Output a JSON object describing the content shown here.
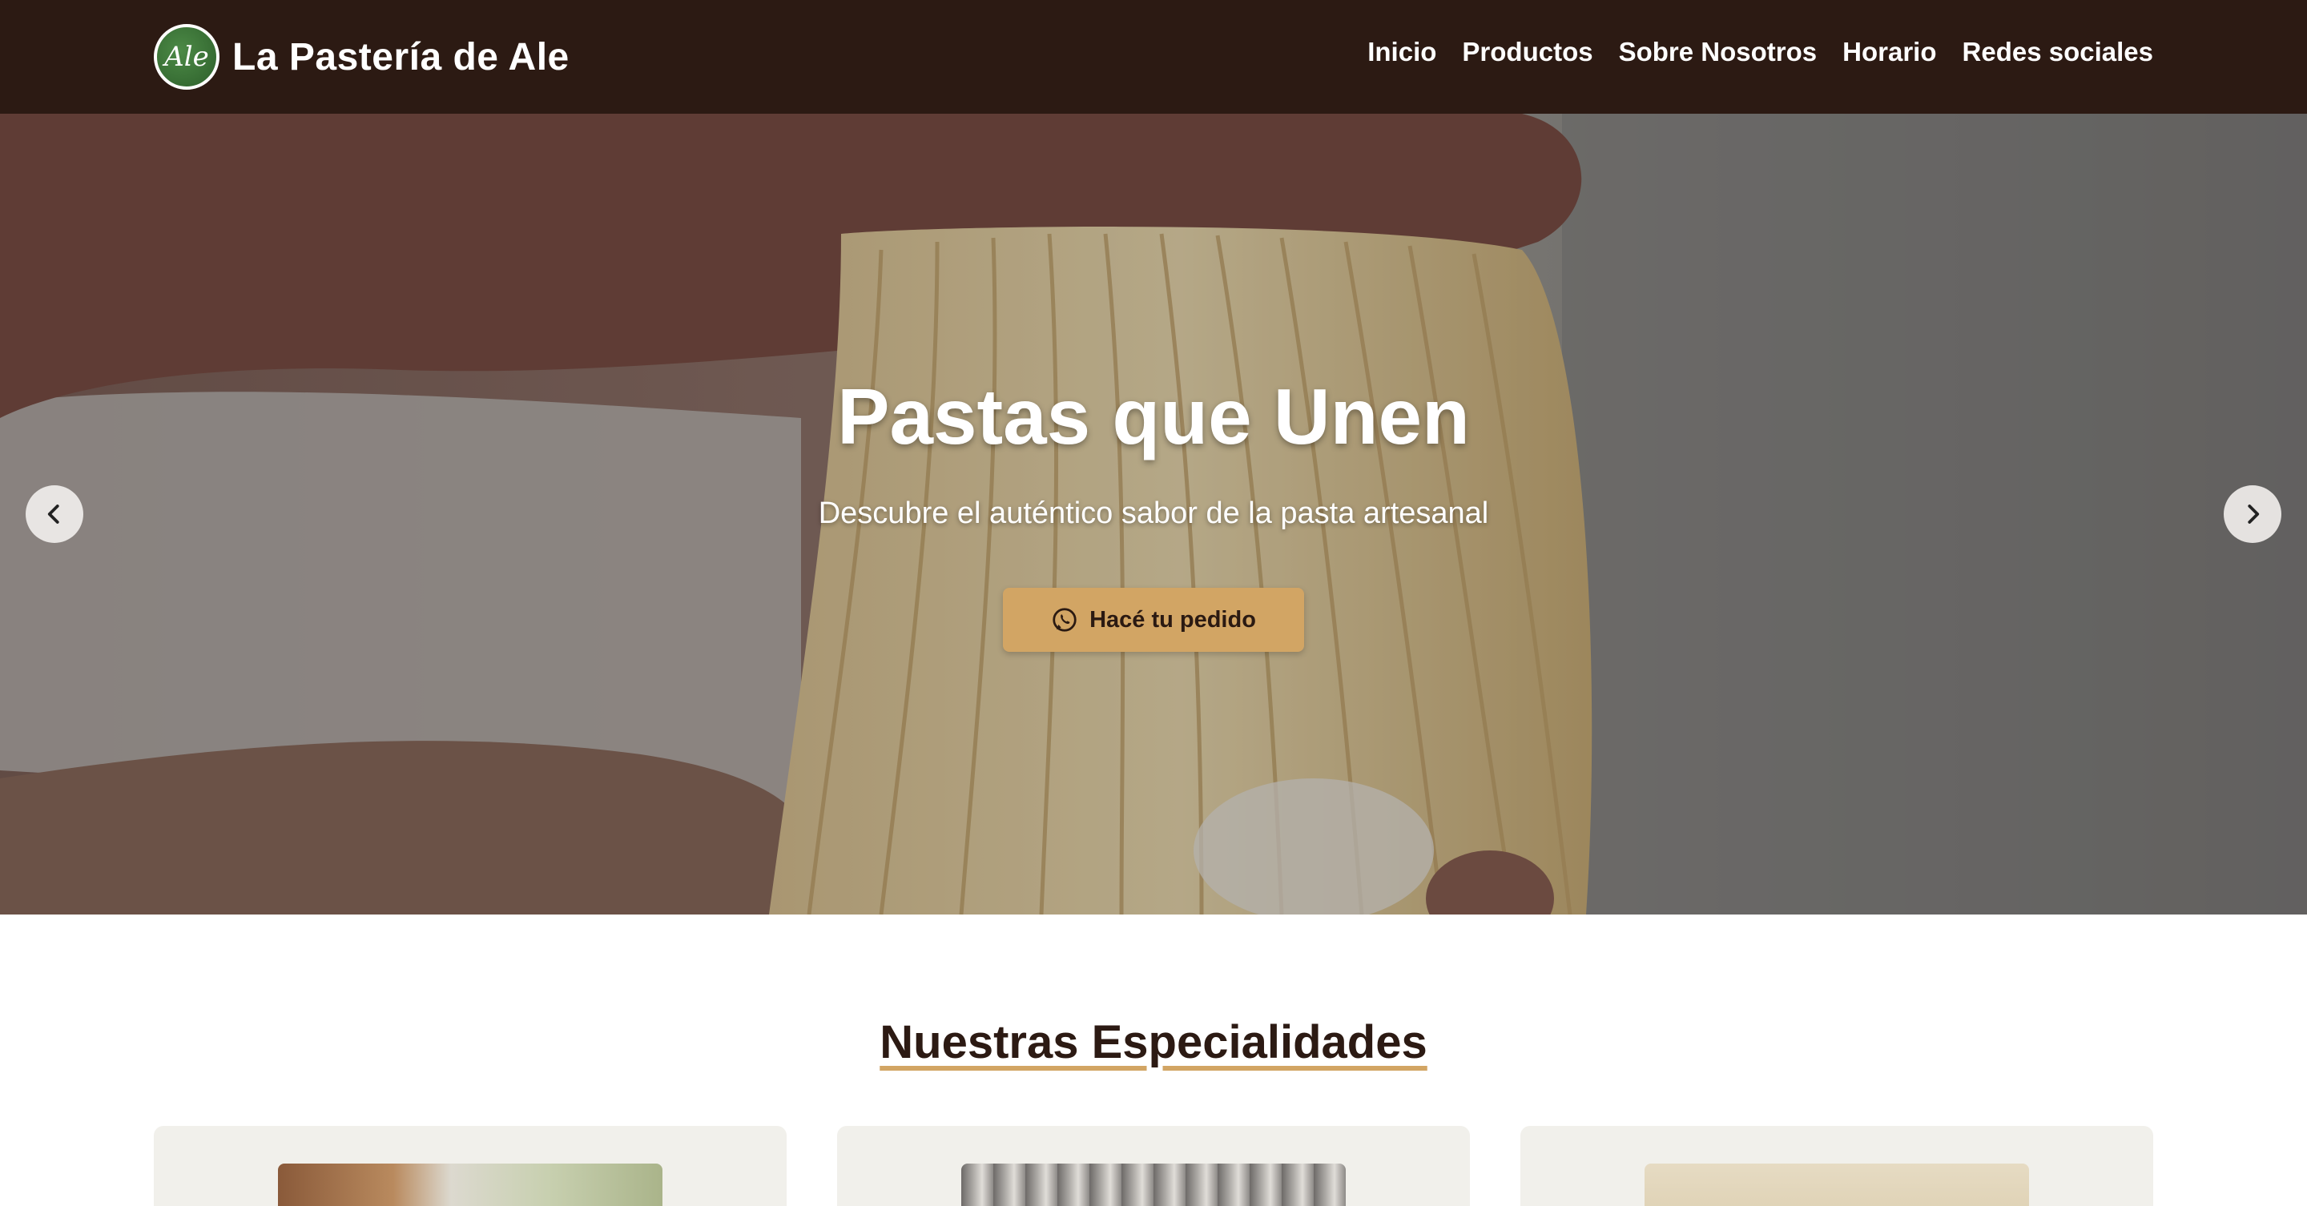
{
  "navbar": {
    "brand_name": "La Pastería de Ale",
    "logo_text": "Ale",
    "links": [
      {
        "label": "Inicio"
      },
      {
        "label": "Productos"
      },
      {
        "label": "Sobre Nosotros"
      },
      {
        "label": "Horario"
      },
      {
        "label": "Redes sociales"
      }
    ]
  },
  "hero": {
    "title": "Pastas que Unen",
    "subtitle": "Descubre el auténtico sabor de la pasta artesanal",
    "cta_label": "Hacé tu pedido",
    "cta_icon": "whatsapp-icon",
    "prev_icon": "chevron-left-icon",
    "next_icon": "chevron-right-icon"
  },
  "specialties": {
    "title": "Nuestras Especialidades"
  },
  "colors": {
    "navbar_bg": "#2c1a13",
    "accent": "#d2a564",
    "card_bg": "#f1f0eb",
    "logo_green": "#3f7a3a"
  }
}
